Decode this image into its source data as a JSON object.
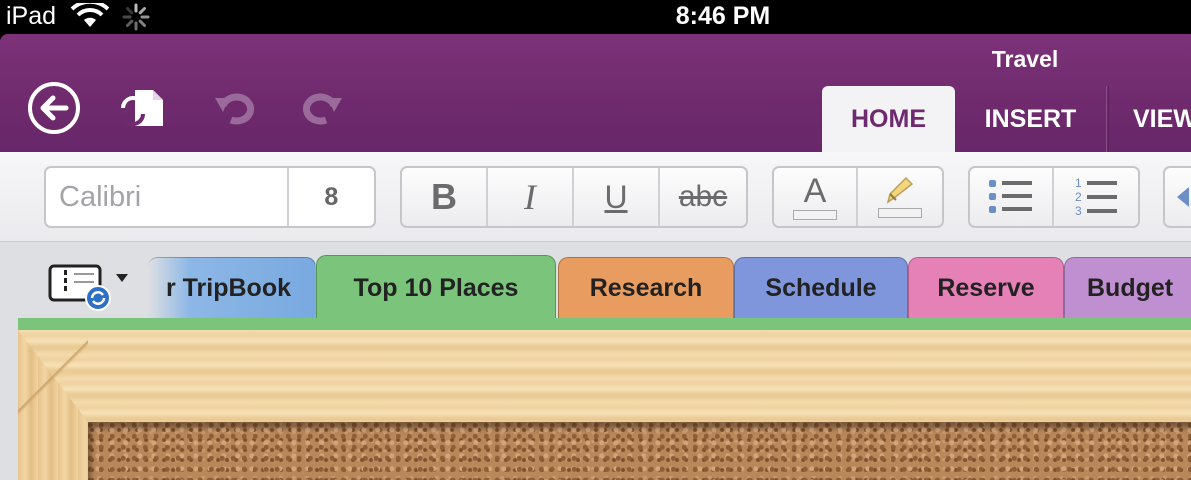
{
  "status_bar": {
    "device": "iPad",
    "time": "8:46 PM"
  },
  "app": {
    "title": "Travel",
    "ribbon_tabs": [
      {
        "label": "HOME",
        "active": true
      },
      {
        "label": "INSERT",
        "active": false
      },
      {
        "label": "VIEW",
        "active": false
      }
    ]
  },
  "toolbar": {
    "font_name_placeholder": "Calibri",
    "font_size": "8",
    "bold_label": "B",
    "italic_label": "I",
    "underline_label": "U",
    "strikethrough_label": "abc",
    "font_color_label": "A"
  },
  "sections": [
    {
      "label": "r TripBook",
      "color": "#78a9e0"
    },
    {
      "label": "Top 10 Places",
      "color": "#7bc47c",
      "active": true
    },
    {
      "label": "Research",
      "color": "#e99c5f"
    },
    {
      "label": "Schedule",
      "color": "#7f96dc"
    },
    {
      "label": "Reserve",
      "color": "#e681b8"
    },
    {
      "label": "Budget",
      "color": "#c08fd2"
    }
  ],
  "colors": {
    "ribbon": "#6f2a6f",
    "active_section": "#7bc47c",
    "highlight": "#f4d77a"
  },
  "icons": [
    "back-arrow-icon",
    "sync-document-icon",
    "undo-icon",
    "redo-icon",
    "highlighter-icon",
    "bullet-list-icon",
    "numbered-list-icon",
    "notebook-sync-icon",
    "wifi-icon",
    "activity-spinner-icon"
  ]
}
